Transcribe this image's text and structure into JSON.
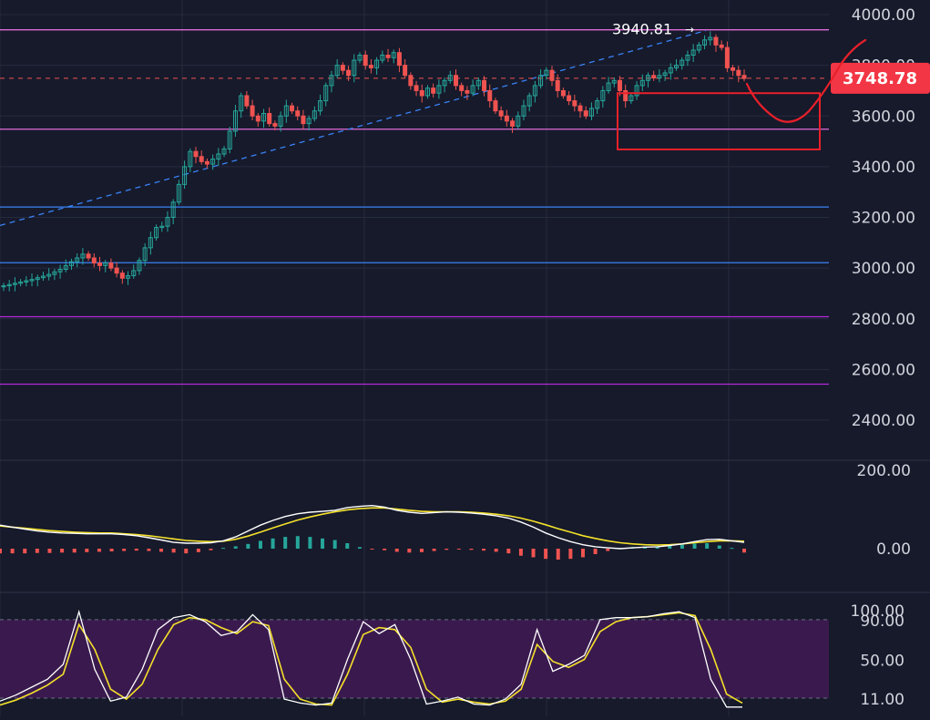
{
  "colors": {
    "background": "#161a2b",
    "grid": "#262b3e",
    "up": "#26a69a",
    "down": "#ef5350",
    "axis_text": "#d1d4dc",
    "macd_line": "#ffffff",
    "signal_line": "#f5e12b",
    "stoch_fill": "#3a1a4e",
    "annotation": "#e8202a"
  },
  "chart_data": [
    {
      "type": "candlestick",
      "y_ticks": [
        "4000.00",
        "3800.00",
        "3600.00",
        "3400.00",
        "3200.00",
        "3000.00",
        "2800.00",
        "2600.00",
        "2400.00"
      ],
      "ylim": [
        2300,
        4060
      ],
      "last_price": 3748.78,
      "last_price_label": "3748.78",
      "high_label": "3940.81",
      "high_value": 3940.81,
      "horizontal_levels": [
        {
          "value": 3940,
          "color": "#e26ad8"
        },
        {
          "value": 3548,
          "color": "#e26ad8"
        },
        {
          "value": 3241,
          "color": "#3b82f6"
        },
        {
          "value": 3021,
          "color": "#3b82f6"
        },
        {
          "value": 2808,
          "color": "#b329d9"
        },
        {
          "value": 2542,
          "color": "#b329d9"
        }
      ],
      "trendline": {
        "start": 3168,
        "end": 3937,
        "color": "#3b82f6"
      },
      "highlight_box": {
        "value_top": 3690,
        "value_bottom": 3468,
        "color": "#e8202a"
      },
      "closes": [
        2930,
        2935,
        2940,
        2945,
        2950,
        2955,
        2962,
        2968,
        2975,
        2985,
        2995,
        3010,
        3025,
        3040,
        3055,
        3040,
        3020,
        3010,
        3020,
        3000,
        2980,
        2960,
        2970,
        2990,
        3030,
        3080,
        3120,
        3160,
        3165,
        3200,
        3260,
        3330,
        3400,
        3460,
        3440,
        3420,
        3410,
        3430,
        3450,
        3470,
        3540,
        3620,
        3680,
        3640,
        3600,
        3580,
        3610,
        3570,
        3560,
        3600,
        3640,
        3620,
        3600,
        3570,
        3590,
        3620,
        3660,
        3720,
        3760,
        3800,
        3780,
        3760,
        3820,
        3840,
        3800,
        3790,
        3820,
        3840,
        3830,
        3850,
        3800,
        3760,
        3720,
        3700,
        3680,
        3710,
        3690,
        3720,
        3740,
        3760,
        3720,
        3700,
        3690,
        3720,
        3740,
        3700,
        3660,
        3620,
        3600,
        3580,
        3560,
        3600,
        3640,
        3680,
        3720,
        3760,
        3780,
        3740,
        3700,
        3680,
        3660,
        3640,
        3620,
        3600,
        3630,
        3660,
        3700,
        3730,
        3740,
        3700,
        3660,
        3680,
        3720,
        3740,
        3760,
        3750,
        3760,
        3770,
        3790,
        3800,
        3820,
        3840,
        3860,
        3880,
        3900,
        3910,
        3880,
        3870,
        3790,
        3780,
        3760,
        3748
      ]
    },
    {
      "type": "macd",
      "y_ticks": [
        "200.00",
        "0.00"
      ],
      "ylim": [
        -45,
        140
      ],
      "macd": [
        60,
        55,
        50,
        45,
        42,
        40,
        39,
        38,
        38,
        38,
        36,
        33,
        28,
        22,
        16,
        14,
        14,
        15,
        20,
        30,
        45,
        60,
        72,
        82,
        89,
        93,
        95,
        98,
        105,
        108,
        110,
        106,
        98,
        93,
        90,
        92,
        94,
        93,
        91,
        88,
        84,
        78,
        68,
        55,
        40,
        28,
        18,
        10,
        5,
        2,
        0,
        2,
        4,
        5,
        8,
        12,
        18,
        23,
        24,
        20,
        16
      ],
      "signal": [
        58,
        55,
        52,
        49,
        46,
        44,
        42,
        41,
        40,
        40,
        38,
        36,
        33,
        29,
        25,
        21,
        19,
        18,
        19,
        24,
        32,
        42,
        53,
        63,
        73,
        81,
        88,
        94,
        99,
        102,
        104,
        104,
        101,
        98,
        95,
        94,
        94,
        94,
        93,
        91,
        88,
        84,
        78,
        70,
        61,
        51,
        42,
        33,
        26,
        20,
        15,
        12,
        10,
        9,
        10,
        12,
        15,
        18,
        20,
        20,
        19
      ],
      "histogram": [
        -12,
        -12,
        -12,
        -11,
        -11,
        -10,
        -10,
        -9,
        -8,
        -7,
        -6,
        -5,
        -6,
        -8,
        -10,
        -12,
        -9,
        -4,
        2,
        6,
        12,
        20,
        26,
        30,
        32,
        30,
        26,
        22,
        14,
        4,
        -2,
        -4,
        -8,
        -10,
        -9,
        -6,
        -3,
        -2,
        -3,
        -5,
        -8,
        -12,
        -18,
        -22,
        -26,
        -28,
        -26,
        -22,
        -14,
        -6,
        2,
        4,
        5,
        6,
        8,
        10,
        13,
        14,
        8,
        2,
        -10
      ]
    },
    {
      "type": "stochastic",
      "y_ticks": [
        "100.00",
        "90.00",
        "50.00",
        "11.00"
      ],
      "ylim": [
        0,
        100
      ],
      "k": [
        8,
        14,
        22,
        30,
        45,
        98,
        40,
        8,
        12,
        40,
        80,
        92,
        95,
        88,
        74,
        78,
        95,
        80,
        10,
        6,
        4,
        6,
        50,
        88,
        76,
        85,
        50,
        5,
        8,
        12,
        5,
        4,
        10,
        25,
        80,
        38,
        45,
        54,
        90,
        92,
        92,
        93,
        96,
        98,
        92,
        30,
        2,
        2
      ],
      "d": [
        4,
        9,
        16,
        24,
        35,
        85,
        60,
        20,
        10,
        25,
        60,
        85,
        92,
        90,
        82,
        76,
        88,
        84,
        30,
        10,
        5,
        4,
        35,
        75,
        82,
        80,
        62,
        20,
        7,
        10,
        7,
        5,
        8,
        20,
        65,
        48,
        42,
        50,
        78,
        88,
        92,
        93,
        95,
        97,
        94,
        60,
        15,
        6
      ]
    }
  ]
}
